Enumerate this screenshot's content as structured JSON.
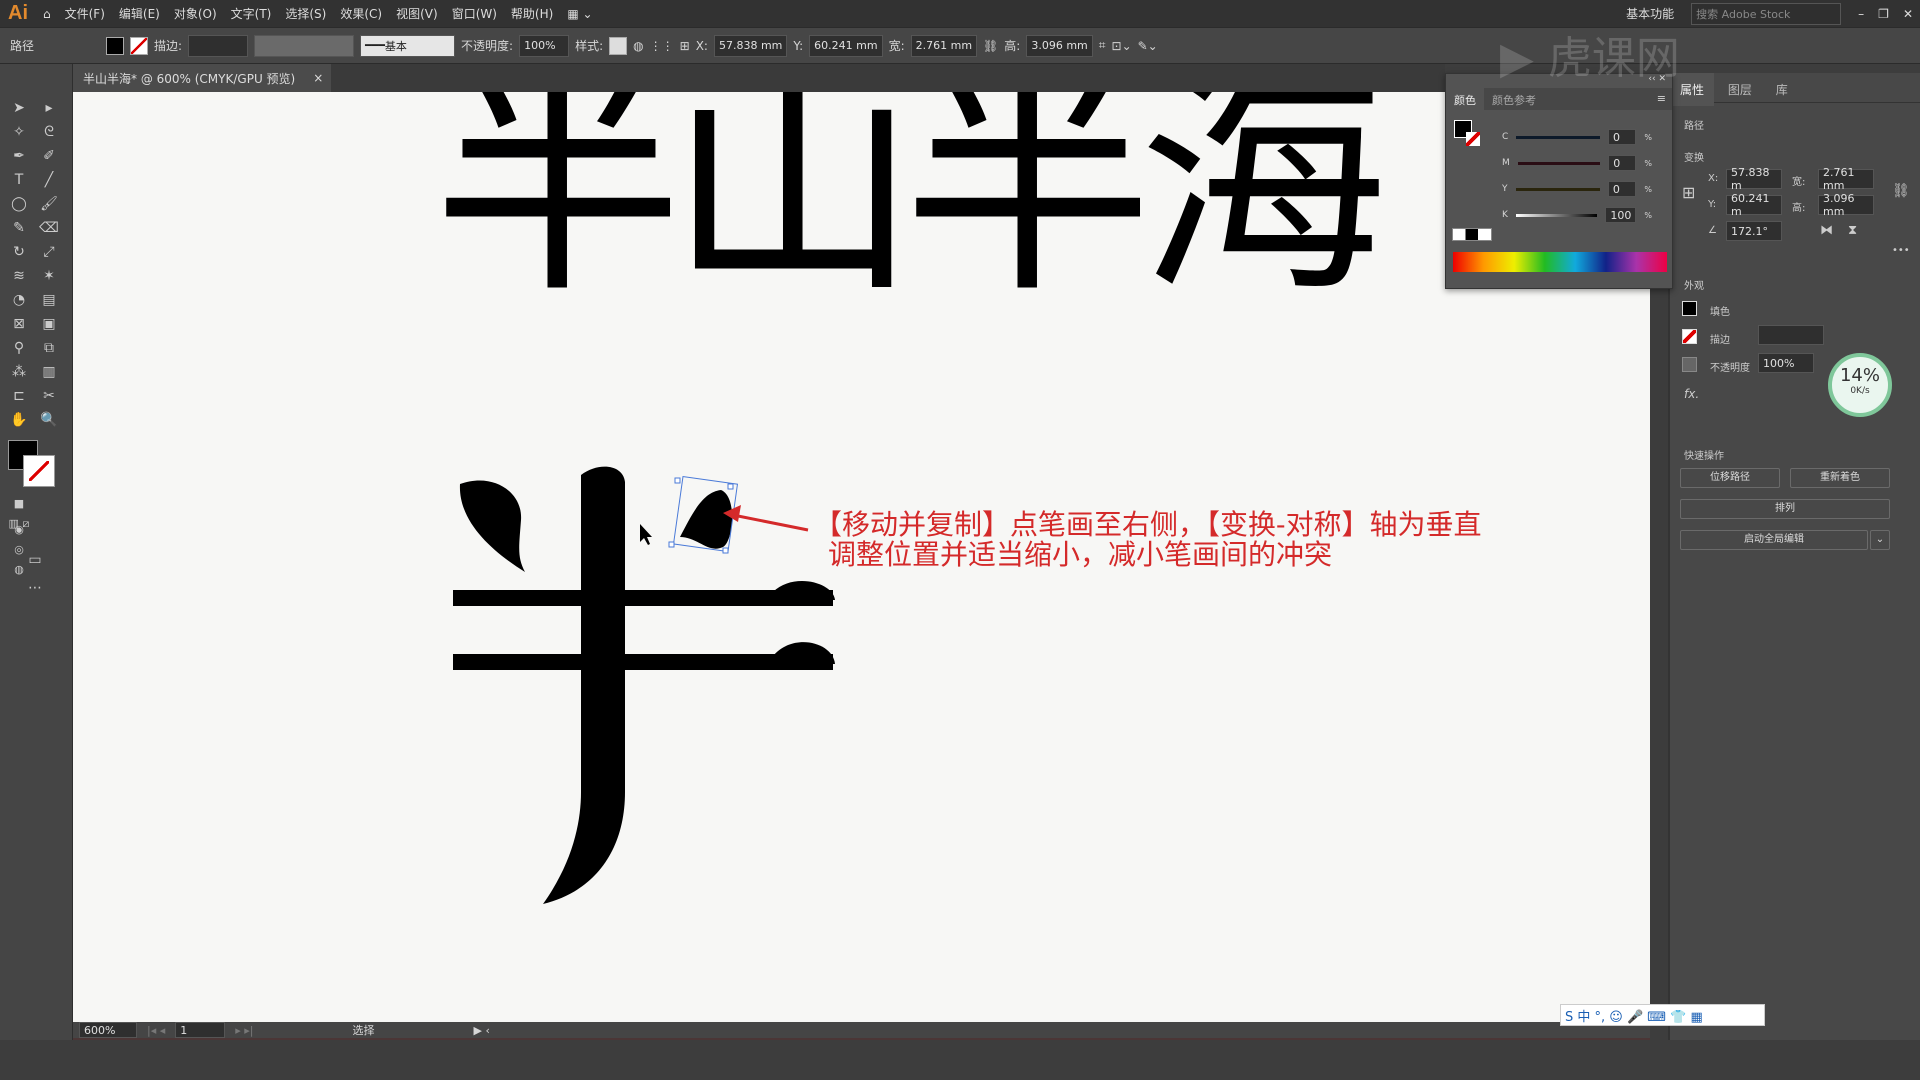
{
  "app": {
    "logo": "Ai",
    "menu": [
      "文件(F)",
      "编辑(E)",
      "对象(O)",
      "文字(T)",
      "选择(S)",
      "效果(C)",
      "视图(V)",
      "窗口(W)",
      "帮助(H)"
    ],
    "workspace": "基本功能",
    "search_placeholder": "搜索 Adobe Stock"
  },
  "control": {
    "object_type": "路径",
    "stroke_label": "描边:",
    "brush": "基本",
    "opacity_label": "不透明度:",
    "opacity": "100%",
    "style_label": "样式:",
    "x_label": "X:",
    "x": "57.838 mm",
    "y_label": "Y:",
    "y": "60.241 mm",
    "w_label": "宽:",
    "w": "2.761 mm",
    "h_label": "高:",
    "h": "3.096 mm"
  },
  "document": {
    "tab": "半山半海* @ 600% (CMYK/GPU 预览)",
    "close": "×"
  },
  "canvas": {
    "top_text": "半山半海",
    "annotation_line1": "【移动并复制】点笔画至右侧，【变换-对称】轴为垂直",
    "annotation_line2": "调整位置并适当缩小，减小笔画间的冲突",
    "annotation_color": "#d42a2a"
  },
  "status": {
    "zoom": "600%",
    "page": "1",
    "tool": "选择"
  },
  "color_panel": {
    "tabs": [
      "颜色",
      "颜色参考"
    ],
    "channels": [
      {
        "name": "C",
        "value": "0"
      },
      {
        "name": "M",
        "value": "0"
      },
      {
        "name": "Y",
        "value": "0"
      },
      {
        "name": "K",
        "value": "100"
      }
    ],
    "unit": "%"
  },
  "properties": {
    "tabs": [
      "属性",
      "图层",
      "库"
    ],
    "section_path": "路径",
    "section_transform": "变换",
    "x_label": "X:",
    "x": "57.838 m",
    "y_label": "Y:",
    "y": "60.241 m",
    "w_label": "宽:",
    "w": "2.761 mm",
    "h_label": "高:",
    "h": "3.096 mm",
    "angle": "172.1°",
    "section_appearance": "外观",
    "fill": "填色",
    "stroke": "描边",
    "opacity_label": "不透明度",
    "opacity": "100%",
    "fx": "fx.",
    "quick_actions": "快速操作",
    "btn_offset": "位移路径",
    "btn_recolor": "重新着色",
    "btn_arrange": "排列",
    "btn_global": "启动全局编辑"
  },
  "net_widget": {
    "percent": "14%",
    "speed": "0K/s"
  },
  "watermark": "虎课网"
}
